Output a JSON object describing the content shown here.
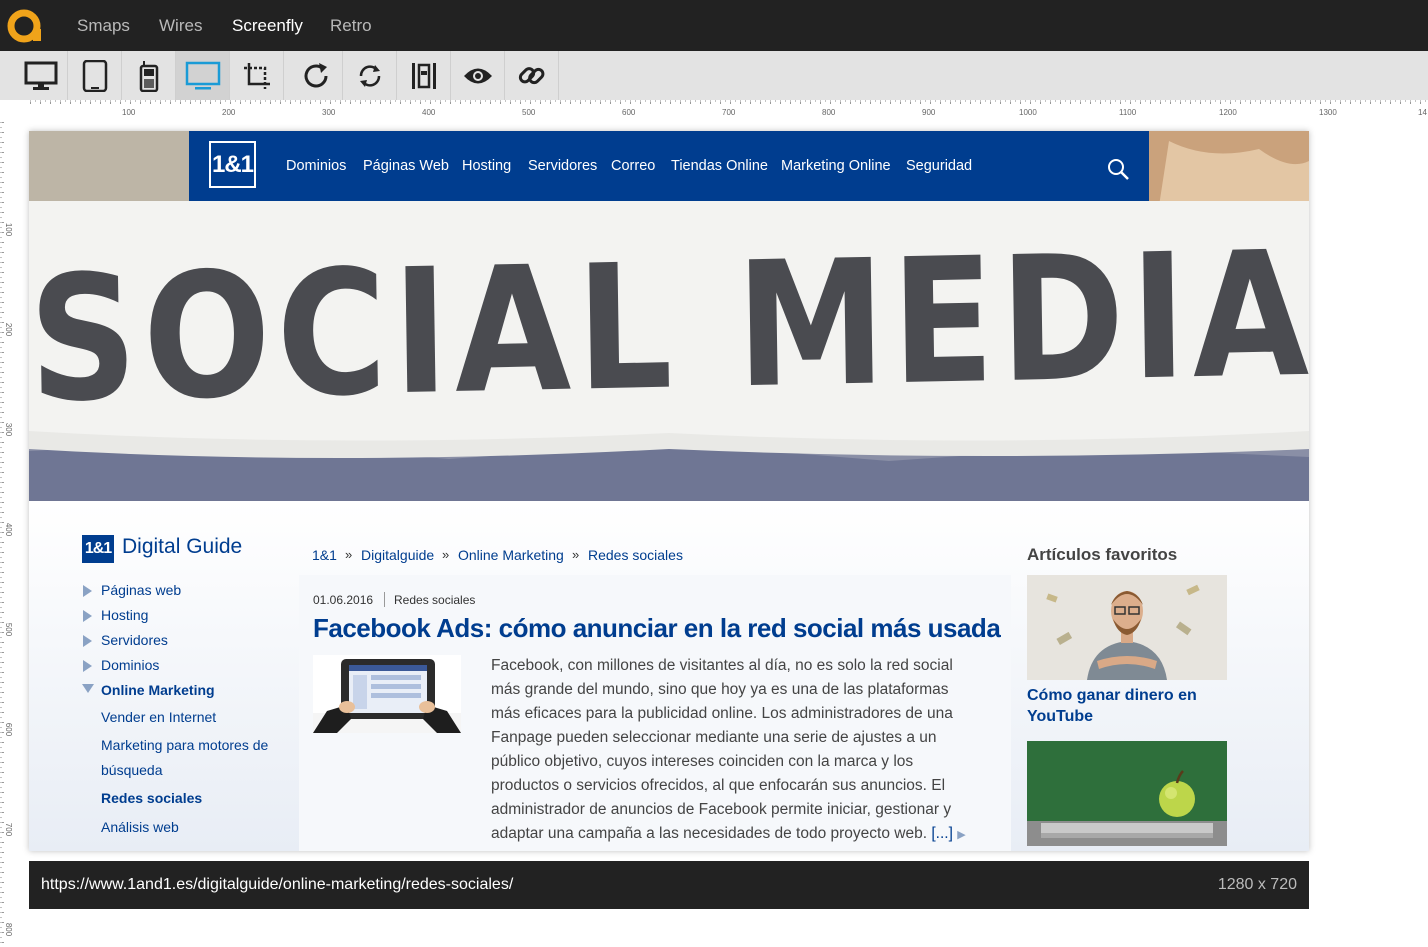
{
  "app": {
    "tabs": [
      {
        "label": "Smaps"
      },
      {
        "label": "Wires"
      },
      {
        "label": "Screenfly"
      },
      {
        "label": "Retro"
      }
    ],
    "active_tab": "Screenfly"
  },
  "toolbar": {
    "tools": [
      {
        "icon": "desktop-icon"
      },
      {
        "icon": "tablet-icon"
      },
      {
        "icon": "mobile-icon"
      },
      {
        "icon": "television-icon"
      },
      {
        "icon": "crop-icon"
      },
      {
        "icon": "refresh-icon"
      },
      {
        "icon": "rotate-icon"
      },
      {
        "icon": "scroll-toggle-icon"
      },
      {
        "icon": "eye-icon"
      },
      {
        "icon": "link-icon"
      }
    ],
    "active_tool": "television-icon"
  },
  "ruler": {
    "top": [
      "100",
      "200",
      "300",
      "400",
      "500",
      "600",
      "700",
      "800",
      "900",
      "1000",
      "1100",
      "1200",
      "1300",
      "14"
    ],
    "left": [
      "100",
      "200",
      "300",
      "400",
      "500",
      "600",
      "700",
      "800"
    ]
  },
  "site": {
    "nav": {
      "logo": "1&1",
      "items": [
        "Dominios",
        "Páginas Web",
        "Hosting",
        "Servidores",
        "Correo",
        "Tiendas Online",
        "Marketing Online",
        "Seguridad"
      ]
    },
    "hero_text": "SOCIAL MEDIA",
    "sidebar": {
      "logo": "1&1",
      "title": "Digital Guide",
      "items": [
        {
          "label": "Páginas web"
        },
        {
          "label": "Hosting"
        },
        {
          "label": "Servidores"
        },
        {
          "label": "Dominios"
        },
        {
          "label": "Online Marketing"
        }
      ],
      "subitems": [
        {
          "label": "Vender en Internet"
        },
        {
          "label": "Marketing para motores de"
        },
        {
          "label": "búsqueda"
        },
        {
          "label": "Redes sociales"
        },
        {
          "label": "Análisis web"
        }
      ]
    },
    "breadcrumb": [
      "1&1",
      "Digitalguide",
      "Online Marketing",
      "Redes sociales"
    ],
    "breadcrumb_sep": "»",
    "article": {
      "date": "01.06.2016",
      "category": "Redes sociales",
      "title": "Facebook Ads: cómo anunciar en la red social más usada",
      "body": "Facebook, con millones de visitantes al día, no es solo la red social más grande del mundo, sino que hoy ya es una de las plataformas más eficaces para la publicidad online. Los administradores de una Fanpage pueden seleccionar mediante una serie de ajustes a un público objetivo, cuyos intereses coinciden con la marca y los productos o servicios ofrecidos, al que enfocarán sus anuncios. El administrador de anuncios de Facebook permite iniciar, gestionar y adaptar una campaña a las necesidades de todo proyecto web.",
      "more": "[...]"
    },
    "favorites": {
      "title": "Artículos favoritos",
      "items": [
        {
          "caption": "Cómo ganar dinero en YouTube"
        }
      ]
    }
  },
  "status": {
    "url": "https://www.1and1.es/digitalguide/online-marketing/redes-sociales/",
    "dimensions": "1280 x 720"
  },
  "colors": {
    "brand_blue": "#003d8f",
    "dark_bar": "#222222",
    "accent_orange": "#f0a31a",
    "active_icon": "#1a9bd6"
  }
}
